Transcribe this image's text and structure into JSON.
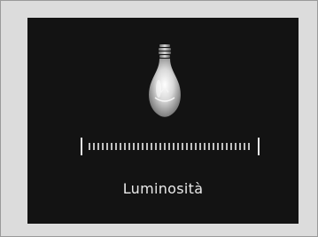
{
  "display": {
    "icon": "light-bulb-icon",
    "setting_label": "Luminosità",
    "brightness_level": 1.0
  },
  "colors": {
    "screen_background": "#131313",
    "frame_background": "#dcdcdc",
    "foreground": "#eaeaea"
  }
}
